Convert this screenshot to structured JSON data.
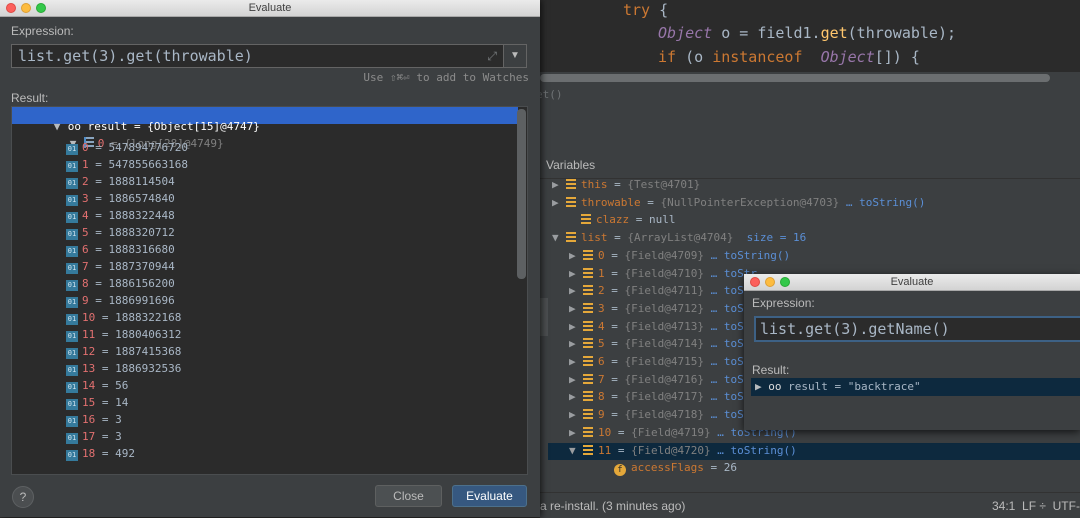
{
  "editor": {
    "line1": {
      "kw": "try",
      "brace": " {"
    },
    "line2": {
      "type": "Object",
      "var": " o = field1.",
      "call": "get",
      "args": "(throwable);"
    },
    "line3": {
      "kw": "if",
      "open": " (o ",
      "instanceof": "instanceof",
      "sp": "  ",
      "type": "Object",
      "tail": "[]) {"
    },
    "frames_ghost": "et()"
  },
  "variables": {
    "title": "Variables",
    "rows": [
      {
        "arrow": "▶",
        "name": "this",
        "eq": " = ",
        "value": "{Test@4701}",
        "link": ""
      },
      {
        "arrow": "▶",
        "name": "throwable",
        "eq": " = ",
        "value": "{NullPointerException@4703}",
        "link": " … toString()"
      },
      {
        "arrow": "",
        "name": "clazz",
        "eq": " = ",
        "value": "null",
        "link": ""
      },
      {
        "arrow": "▼",
        "name": "list",
        "eq": " = ",
        "value": "{ArrayList@4704}",
        "link": "  size = 16"
      },
      {
        "arrow": "▶",
        "name": "0",
        "eq": " = ",
        "value": "{Field@4709}",
        "link": " … toString()"
      },
      {
        "arrow": "▶",
        "name": "1",
        "eq": " = ",
        "value": "{Field@4710}",
        "link": " … toStr"
      },
      {
        "arrow": "▶",
        "name": "2",
        "eq": " = ",
        "value": "{Field@4711}",
        "link": " … toStr"
      },
      {
        "arrow": "▶",
        "name": "3",
        "eq": " = ",
        "value": "{Field@4712}",
        "link": " … toStr"
      },
      {
        "arrow": "▶",
        "name": "4",
        "eq": " = ",
        "value": "{Field@4713}",
        "link": " … toStr"
      },
      {
        "arrow": "▶",
        "name": "5",
        "eq": " = ",
        "value": "{Field@4714}",
        "link": " … toStr"
      },
      {
        "arrow": "▶",
        "name": "6",
        "eq": " = ",
        "value": "{Field@4715}",
        "link": " … toStr"
      },
      {
        "arrow": "▶",
        "name": "7",
        "eq": " = ",
        "value": "{Field@4716}",
        "link": " … toStr"
      },
      {
        "arrow": "▶",
        "name": "8",
        "eq": " = ",
        "value": "{Field@4717}",
        "link": " … toStr"
      },
      {
        "arrow": "▶",
        "name": "9",
        "eq": " = ",
        "value": "{Field@4718}",
        "link": " … toStr"
      },
      {
        "arrow": "▶",
        "name": "10",
        "eq": " = ",
        "value": "{Field@4719}",
        "link": " … toString()"
      },
      {
        "arrow": "▼",
        "name": "11",
        "eq": " = ",
        "value": "{Field@4720}",
        "link": " … toString()"
      },
      {
        "arrow": "",
        "name": "accessFlags",
        "eq": " = ",
        "value": "26",
        "link": ""
      }
    ]
  },
  "status": {
    "message": "a re-install. (3 minutes ago)",
    "position": "34:1  LF ÷  UTF-"
  },
  "dialog1": {
    "title": "Evaluate",
    "expression_label": "Expression:",
    "expression": "list.get(3).get(throwable)",
    "expand_icon": "⤢",
    "history_icon": "▼",
    "watch_hint": "Use ⇧⌘⏎ to add to Watches",
    "result_label": "Result:",
    "result_row": {
      "arrow": "▼",
      "icon": "oo",
      "text": " result = {Object[15]@4747}"
    },
    "array_row": {
      "arrow": "▼",
      "index": "0",
      "text": " = {long[28]@4749}"
    },
    "items": [
      {
        "i": "0",
        "v": " = 547894776720"
      },
      {
        "i": "1",
        "v": " = 547855663168"
      },
      {
        "i": "2",
        "v": " = 1888114504"
      },
      {
        "i": "3",
        "v": " = 1886574840"
      },
      {
        "i": "4",
        "v": " = 1888322448"
      },
      {
        "i": "5",
        "v": " = 1888320712"
      },
      {
        "i": "6",
        "v": " = 1888316680"
      },
      {
        "i": "7",
        "v": " = 1887370944"
      },
      {
        "i": "8",
        "v": " = 1886156200"
      },
      {
        "i": "9",
        "v": " = 1886991696"
      },
      {
        "i": "10",
        "v": " = 1888322168"
      },
      {
        "i": "11",
        "v": " = 1880406312"
      },
      {
        "i": "12",
        "v": " = 1887415368"
      },
      {
        "i": "13",
        "v": " = 1886932536"
      },
      {
        "i": "14",
        "v": " = 56"
      },
      {
        "i": "15",
        "v": " = 14"
      },
      {
        "i": "16",
        "v": " = 3"
      },
      {
        "i": "17",
        "v": " = 3"
      },
      {
        "i": "18",
        "v": " = 492"
      }
    ],
    "badge": "01",
    "help_label": "?",
    "close_label": "Close",
    "evaluate_label": "Evaluate"
  },
  "dialog2": {
    "title": "Evaluate",
    "expression_label": "Expression:",
    "expression": "list.get(3).getName()",
    "result_label": "Result:",
    "result_arrow": "▶",
    "result_icon": "oo",
    "result_text": " result = \"backtrace\""
  }
}
